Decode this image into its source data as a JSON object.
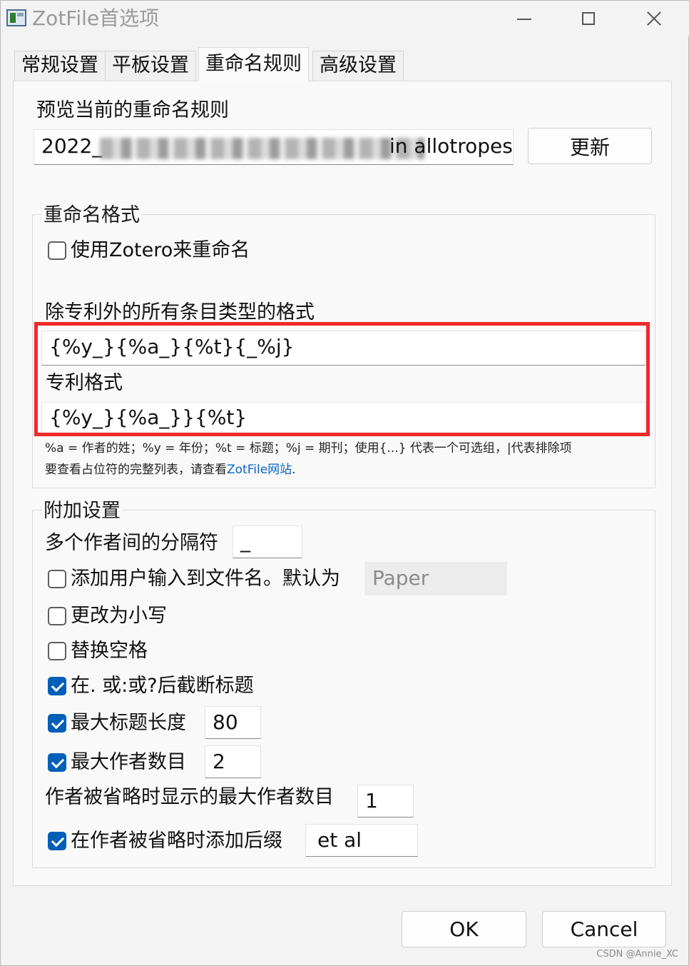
{
  "window": {
    "title": "ZotFile首选项"
  },
  "tabs": [
    {
      "label": "常规设置"
    },
    {
      "label": "平板设置"
    },
    {
      "label": "重命名规则"
    },
    {
      "label": "高级设置"
    }
  ],
  "preview": {
    "label": "预览当前的重命名规则",
    "value_start": "2022_",
    "value_end": "in allotropes",
    "update_button": "更新"
  },
  "rename_format": {
    "legend": "重命名格式",
    "use_zotero_label": "使用Zotero来重命名",
    "use_zotero_checked": false,
    "general_format_label": "除专利外的所有条目类型的格式",
    "general_format_value": "{%y_}{%a_}{%t}{_%j}",
    "patent_format_label": "专利格式",
    "patent_format_value": "{%y_}{%a_}}{%t}",
    "hint_line1": "%a = 作者的姓；%y = 年份；%t = 标题；%j = 期刊；使用{...} 代表一个可选组，|代表排除项",
    "hint_line2_prefix": "要查看占位符的完整列表，请查看",
    "hint_link": "ZotFile网站",
    "hint_line2_suffix": "."
  },
  "additional": {
    "legend": "附加设置",
    "separator_label": "多个作者间的分隔符",
    "separator_value": "_",
    "add_user_input_label": "添加用户输入到文件名。默认为",
    "add_user_input_checked": false,
    "add_user_input_value": "Paper",
    "lowercase_label": "更改为小写",
    "lowercase_checked": false,
    "replace_spaces_label": "替换空格",
    "replace_spaces_checked": false,
    "truncate_label": "在. 或:或?后截断标题",
    "truncate_checked": true,
    "max_title_label": "最大标题长度",
    "max_title_checked": true,
    "max_title_value": "80",
    "max_authors_label": "最大作者数目",
    "max_authors_checked": true,
    "max_authors_value": "2",
    "max_authors_truncated_label": "作者被省略时显示的最大作者数目",
    "max_authors_truncated_value": "1",
    "suffix_label": "在作者被省略时添加后缀",
    "suffix_checked": true,
    "suffix_value": "et al"
  },
  "footer": {
    "ok_button": "OK",
    "cancel_button": "Cancel"
  },
  "watermark": "CSDN @Annie_XC"
}
